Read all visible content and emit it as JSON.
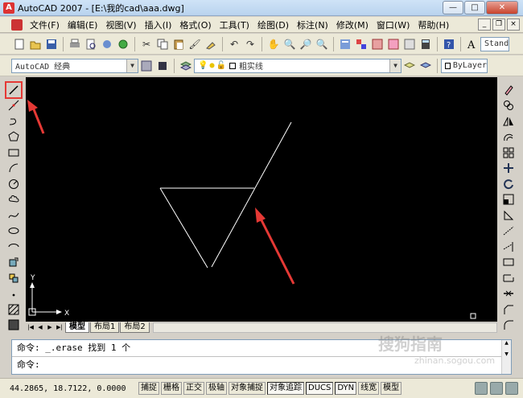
{
  "window": {
    "title": "AutoCAD 2007 - [E:\\我的cad\\aaa.dwg]",
    "minimize": "—",
    "maximize": "□",
    "close": "✕"
  },
  "menu": {
    "items": [
      "文件(F)",
      "编辑(E)",
      "视图(V)",
      "插入(I)",
      "格式(O)",
      "工具(T)",
      "绘图(D)",
      "标注(N)",
      "修改(M)",
      "窗口(W)",
      "帮助(H)"
    ],
    "min": "_",
    "restore": "❐",
    "close": "×"
  },
  "toolbar1": {
    "text_style_combo": "Stand"
  },
  "toolbar2": {
    "workspace": "AutoCAD 经典",
    "layer": "粗实线",
    "color": "ByLayer"
  },
  "canvas": {
    "ucs_y": "Y",
    "ucs_x": "X",
    "line_color": "#ffffff",
    "arrow_color": "#e53935"
  },
  "tabs": {
    "model": "模型",
    "layout1": "布局1",
    "layout2": "布局2"
  },
  "command": {
    "history": "命令: _.erase 找到 1 个",
    "prompt": "命令:"
  },
  "watermark": {
    "text": "搜狗指南",
    "url": "zhinan.sogou.com"
  },
  "status": {
    "coords": "44.2865, 18.7122, 0.0000",
    "buttons": [
      "捕捉",
      "栅格",
      "正交",
      "极轴",
      "对象捕捉",
      "对象追踪",
      "DUCS",
      "DYN",
      "线宽",
      "模型"
    ]
  }
}
